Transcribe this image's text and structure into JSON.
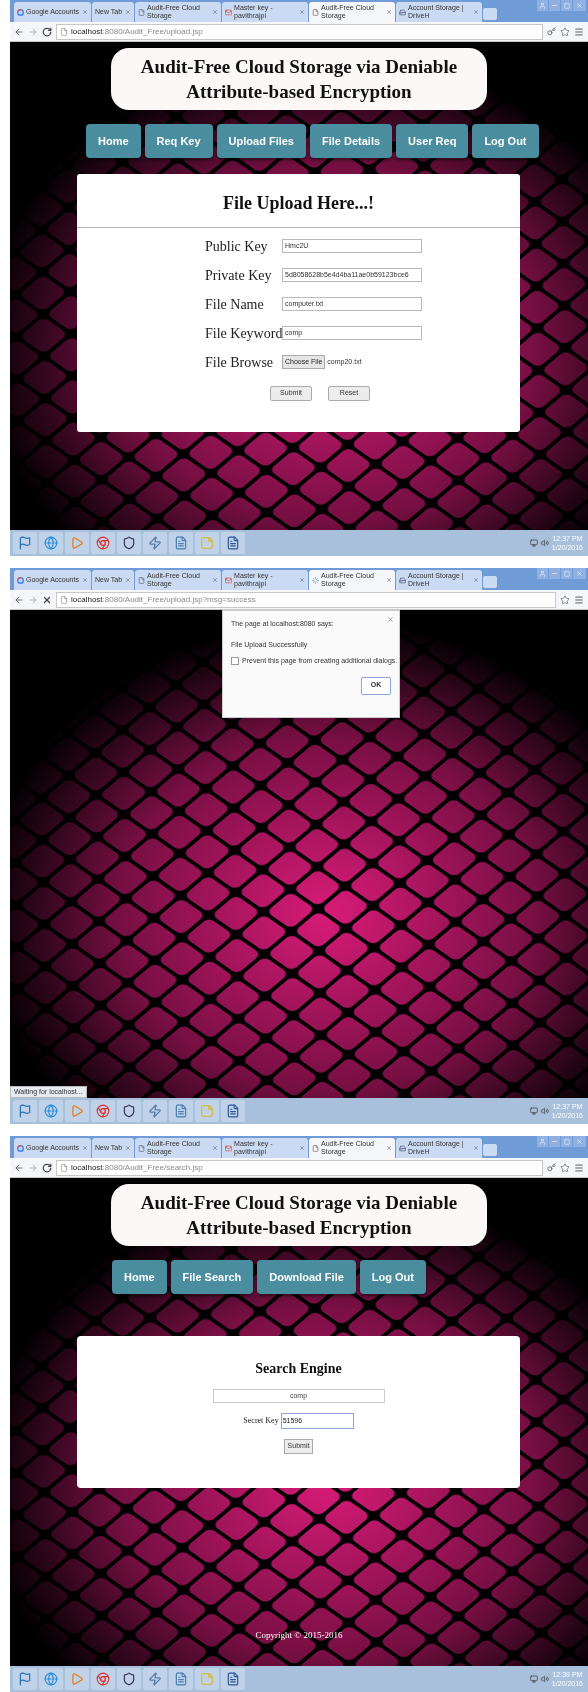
{
  "screens": [
    {
      "kind": "upload",
      "loading": false,
      "extension_icon": true,
      "tabs": [
        {
          "title": "Google Accounts",
          "kind": "google",
          "selected": false
        },
        {
          "title": "New Tab",
          "kind": "none",
          "selected": false
        },
        {
          "title": "Audit-Free Cloud Storage",
          "kind": "page",
          "selected": false
        },
        {
          "title": "Master key - pavithrajpi",
          "kind": "mail",
          "selected": false
        },
        {
          "title": "Audit-Free Cloud Storage",
          "kind": "page",
          "selected": true
        },
        {
          "title": "Account Storage | DriveH",
          "kind": "drive",
          "selected": false
        }
      ],
      "address": "**localhost**:8080/Audit_Free/upload.jsp",
      "page": {
        "heading": "Audit-Free Cloud Storage via Deniable Attribute-based Encryption",
        "nav": [
          "Home",
          "Req Key",
          "Upload Files",
          "File Details",
          "User Req",
          "Log Out"
        ],
        "form_title": "File Upload Here...!",
        "fields": [
          {
            "label": "Public Key",
            "kind": "text",
            "value": "Hmc2U"
          },
          {
            "label": "Private Key",
            "kind": "text",
            "value": "5d8058628b5e4d4ba11ae0b59123bce6"
          },
          {
            "label": "File Name",
            "kind": "text",
            "value": "computer.txt"
          },
          {
            "label": "File Keyword",
            "kind": "text",
            "value": "comp"
          },
          {
            "label": "File Browse",
            "kind": "file",
            "button": "Choose File",
            "value": "comp20.txt"
          }
        ],
        "buttons": [
          "Submit",
          "Reset"
        ]
      },
      "taskbar": {
        "time": "12:37 PM",
        "date": "1/20/2016"
      }
    },
    {
      "kind": "alert",
      "loading": true,
      "extension_icon": false,
      "tabs": [
        {
          "title": "Google Accounts",
          "kind": "google",
          "selected": false
        },
        {
          "title": "New Tab",
          "kind": "none",
          "selected": false
        },
        {
          "title": "Audit-Free Cloud Storage",
          "kind": "page",
          "selected": false
        },
        {
          "title": "Master key - pavithrajpi",
          "kind": "mail",
          "selected": false
        },
        {
          "title": "Audit-Free Cloud Storage",
          "kind": "loading",
          "selected": true
        },
        {
          "title": "Account Storage | DriveH",
          "kind": "drive",
          "selected": false
        }
      ],
      "address": "**localhost**:8080/Audit_Free/upload.jsp?msg=success",
      "dialog": {
        "header": "The page at localhost:8080 says:",
        "message": "File Upload Successfully",
        "checkbox": {
          "label": "Prevent this page from creating additional dialogs.",
          "checked": false
        },
        "button": "OK"
      },
      "status": "Waiting for localhost...",
      "taskbar": {
        "time": "12:37 PM",
        "date": "1/20/2016"
      }
    },
    {
      "kind": "search",
      "loading": false,
      "extension_icon": true,
      "tabs": [
        {
          "title": "Google Accounts",
          "kind": "google",
          "selected": false
        },
        {
          "title": "New Tab",
          "kind": "none",
          "selected": false
        },
        {
          "title": "Audit-Free Cloud Storage",
          "kind": "page",
          "selected": false
        },
        {
          "title": "Master key - pavithrajpi",
          "kind": "mail",
          "selected": false
        },
        {
          "title": "Audit-Free Cloud Storage",
          "kind": "page",
          "selected": true
        },
        {
          "title": "Account Storage | DriveH",
          "kind": "drive",
          "selected": false
        }
      ],
      "address": "**localhost**:8080/Audit_Free/search.jsp",
      "page": {
        "heading": "Audit-Free Cloud Storage via Deniable Attribute-based Encryption",
        "nav": [
          "Home",
          "File Search",
          "Download File",
          "Log Out"
        ],
        "search_title": "Search Engine",
        "query": "comp",
        "key_label": "Secret Key",
        "key_value": "51596",
        "button": "Submit",
        "copyright": "Copyright © 2015-2016"
      },
      "taskbar": {
        "time": "12:39 PM",
        "date": "1/20/2016"
      }
    }
  ]
}
